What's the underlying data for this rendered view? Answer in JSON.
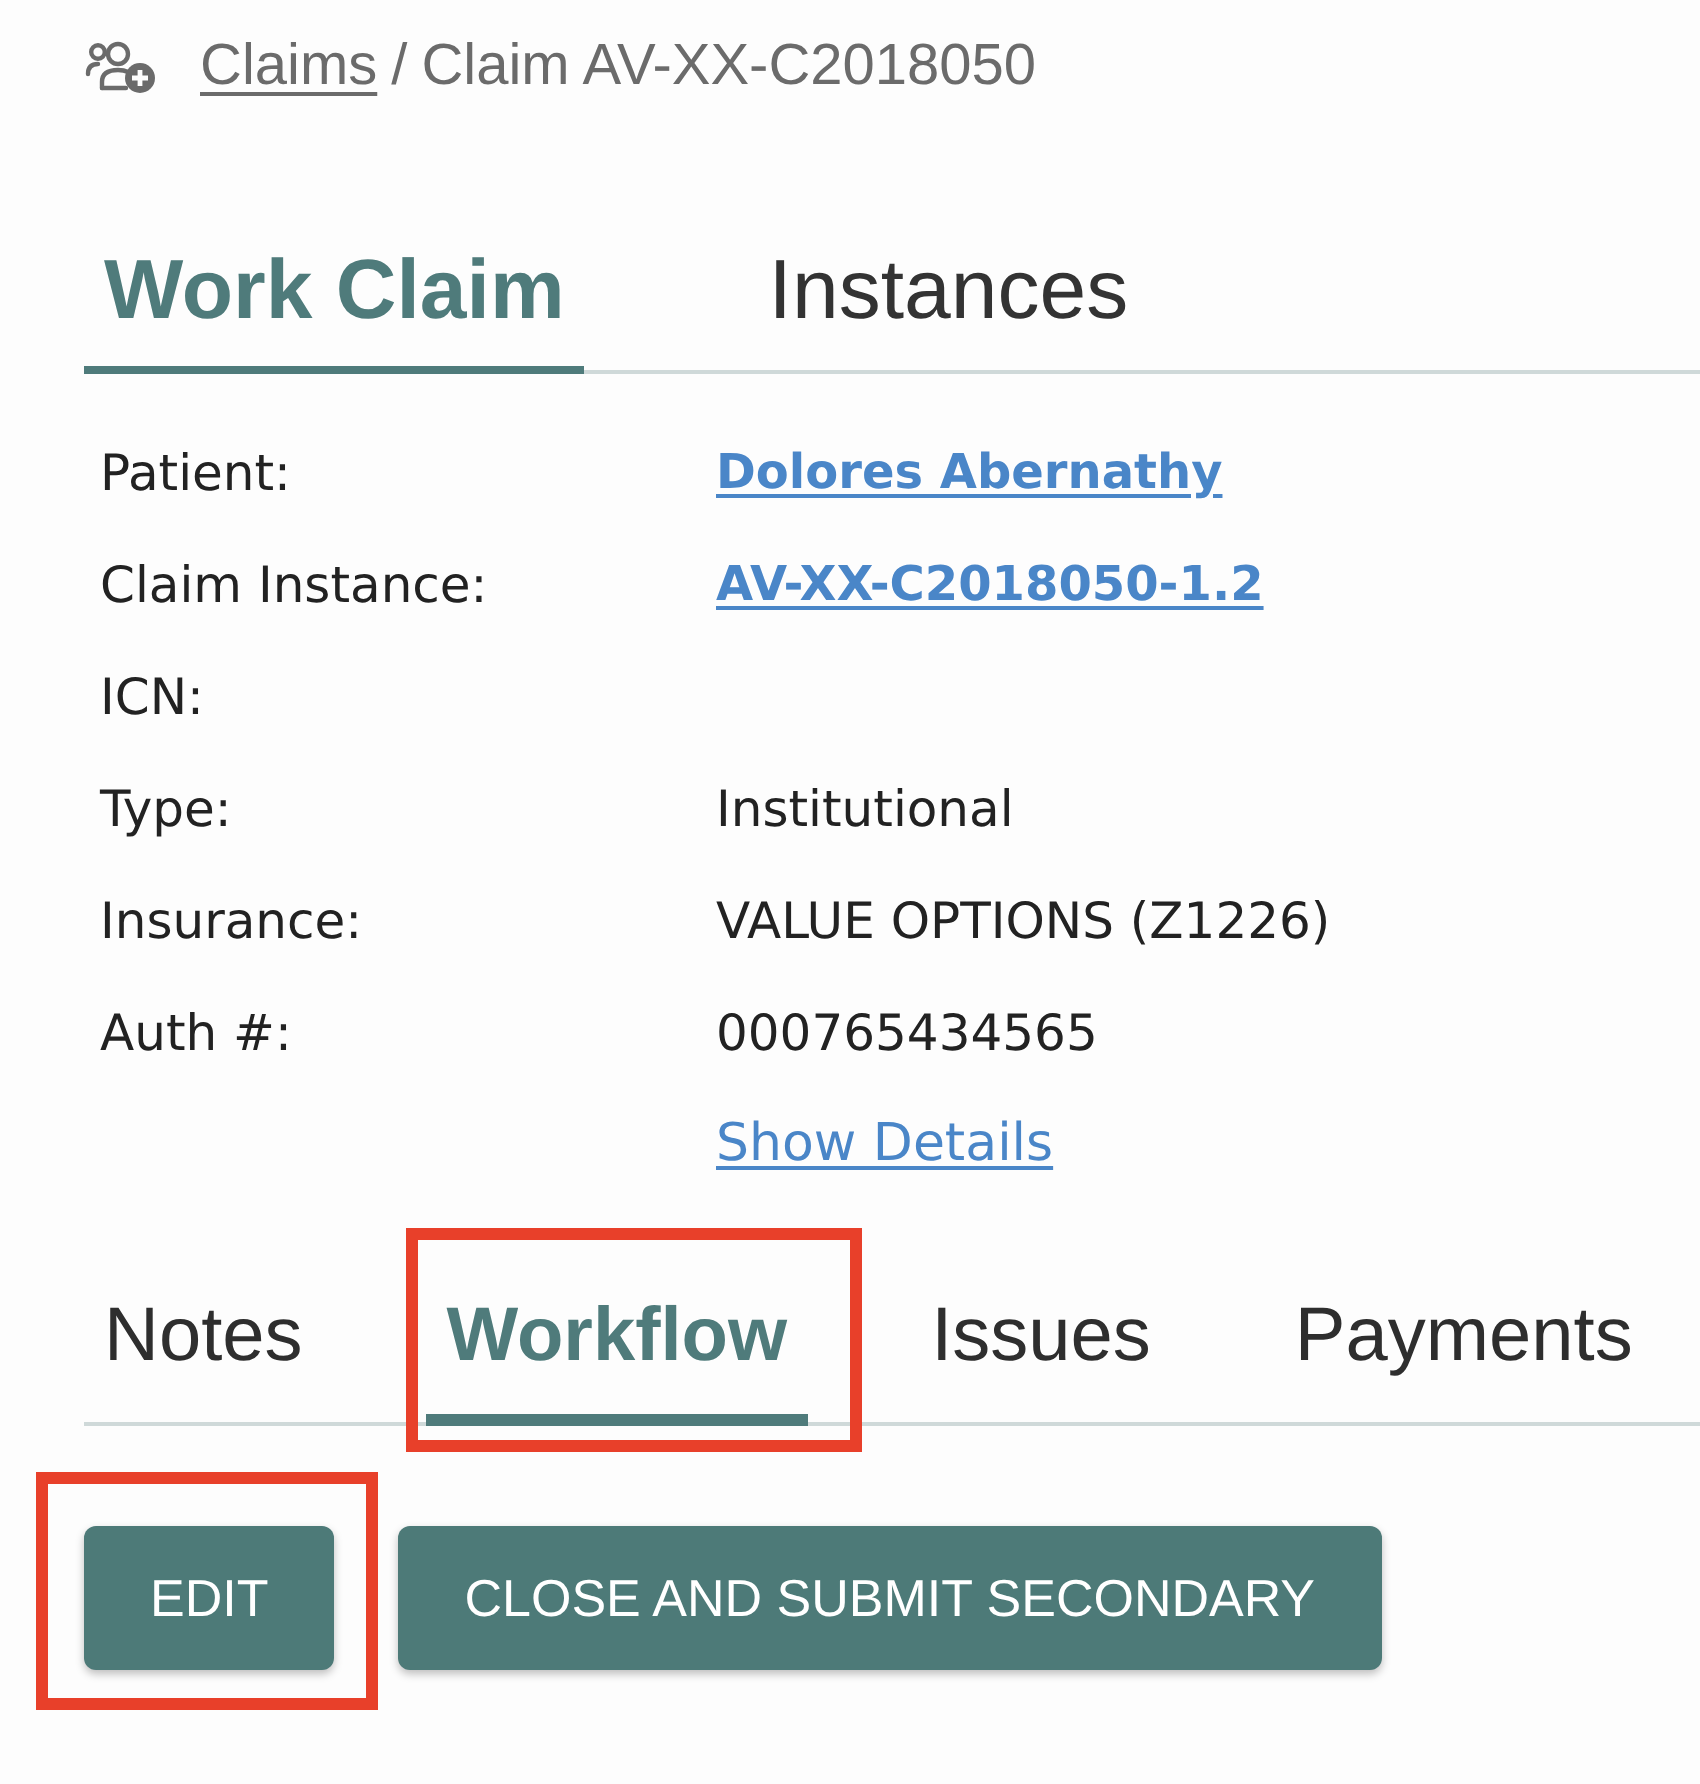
{
  "breadcrumb": {
    "link": "Claims",
    "separator": "/",
    "current": "Claim AV-XX-C2018050"
  },
  "main_tabs": [
    {
      "label": "Work Claim",
      "selected": true
    },
    {
      "label": "Instances",
      "selected": false
    }
  ],
  "details": [
    {
      "label": "Patient:",
      "value": "Dolores Abernathy",
      "kind": "link"
    },
    {
      "label": "Claim Instance:",
      "value": "AV-XX-C2018050-1.2",
      "kind": "link"
    },
    {
      "label": "ICN:"
    },
    {
      "label": "Type:",
      "value": "Institutional",
      "kind": "text"
    },
    {
      "label": "Insurance:",
      "value": "VALUE OPTIONS (Z1226)",
      "kind": "text"
    },
    {
      "label": "Auth #:",
      "value": "000765434565",
      "kind": "text"
    }
  ],
  "show_details_link": "Show Details",
  "section_tabs": [
    {
      "label": "Notes",
      "selected": false,
      "highlighted": false
    },
    {
      "label": "Workflow",
      "selected": true,
      "highlighted": true
    },
    {
      "label": "Issues",
      "selected": false,
      "highlighted": false
    },
    {
      "label": "Payments",
      "selected": false,
      "highlighted": false
    }
  ],
  "actions": [
    {
      "label": "EDIT",
      "highlighted": true
    },
    {
      "label": "CLOSE AND SUBMIT SECONDARY",
      "highlighted": false
    }
  ]
}
